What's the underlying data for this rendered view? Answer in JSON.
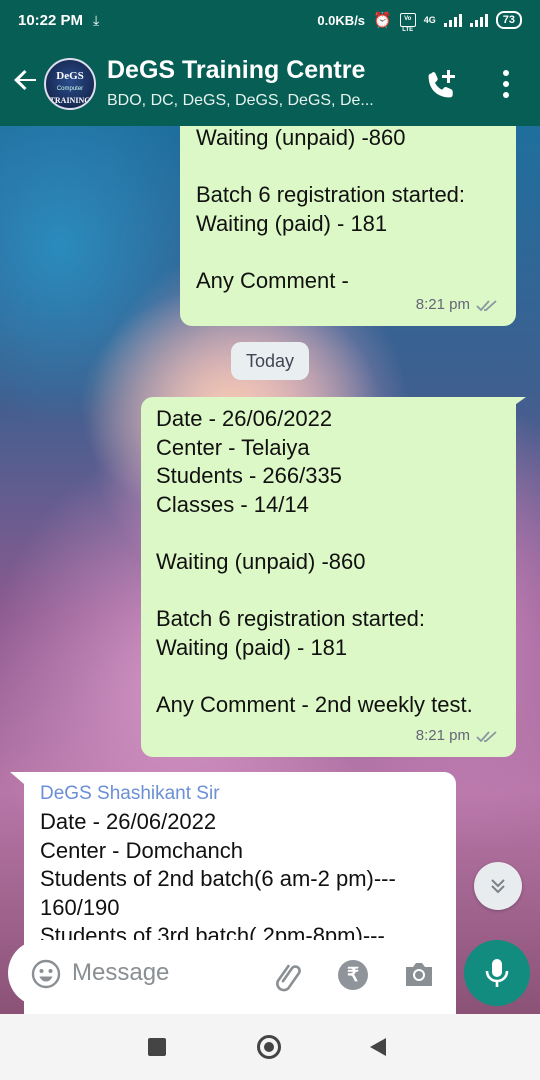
{
  "status_bar": {
    "time": "10:22 PM",
    "network_speed": "0.0KB/s",
    "volte_label": "Vo LTE",
    "network_type": "4G",
    "battery": "73"
  },
  "header": {
    "title": "DeGS Training Centre",
    "subtitle": "BDO, DC, DeGS, DeGS, DeGS, De...",
    "avatar_text": {
      "top": "DeGS",
      "middle": "Computer",
      "bottom": "TRAINING"
    }
  },
  "messages": [
    {
      "direction": "outgoing",
      "lines": [
        "Waiting (unpaid) -860",
        "",
        "Batch 6 registration started:",
        "Waiting (paid) - 181",
        "",
        "Any Comment -"
      ],
      "time": "8:21 pm",
      "status": "read"
    },
    {
      "direction": "outgoing",
      "lines": [
        "Date - 26/06/2022",
        "Center - Telaiya",
        "Students - 266/335",
        "Classes - 14/14",
        "",
        "Waiting (unpaid) -860",
        "",
        "Batch 6 registration started:",
        "Waiting (paid) - 181",
        "",
        "Any Comment - 2nd weekly test."
      ],
      "time": "8:21 pm",
      "status": "read"
    },
    {
      "direction": "incoming",
      "sender": "DeGS Shashikant Sir",
      "lines": [
        "Date - 26/06/2022",
        "Center - Domchanch",
        "Students of 2nd batch(6 am-2 pm)---",
        "160/190",
        "Students of 3rd batch( 2pm-8pm)---"
      ]
    }
  ],
  "date_divider": "Today",
  "input": {
    "placeholder": "Message"
  },
  "colors": {
    "header_bg": "#075e54",
    "outgoing_bubble": "#dcf8c6",
    "incoming_bubble": "#ffffff",
    "sender_name": "#6b8fd6",
    "mic_button": "#128c7e"
  }
}
